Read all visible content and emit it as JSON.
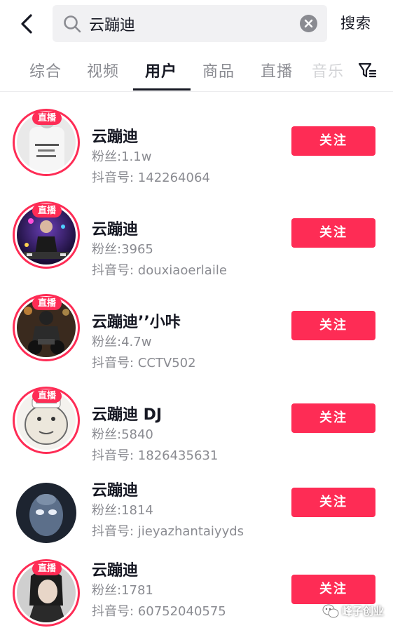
{
  "search": {
    "query": "云蹦迪",
    "button_label": "搜索"
  },
  "tabs": [
    {
      "label": "综合"
    },
    {
      "label": "视频"
    },
    {
      "label": "用户"
    },
    {
      "label": "商品"
    },
    {
      "label": "直播"
    },
    {
      "label": "音乐"
    }
  ],
  "active_tab": "用户",
  "colors": {
    "accent": "#fe2c55",
    "text_primary": "#161823",
    "text_secondary": "#8a8b91"
  },
  "users": [
    {
      "name": "云蹦迪",
      "fans": "粉丝:1.1w",
      "dy_id": "抖音号: 142264064",
      "live": "直播",
      "follow": "关注"
    },
    {
      "name": "云蹦迪",
      "fans": "粉丝:3965",
      "dy_id": "抖音号: douxiaoerlaile",
      "live": "直播",
      "follow": "关注"
    },
    {
      "name": "云蹦迪’’小咔",
      "fans": "粉丝:4.7w",
      "dy_id": "抖音号: CCTV502",
      "live": "直播",
      "follow": "关注"
    },
    {
      "name": "云蹦迪 DJ",
      "fans": "粉丝:5840",
      "dy_id": "抖音号: 1826435631",
      "live": "直播",
      "follow": "关注"
    },
    {
      "name": "云蹦迪",
      "fans": "粉丝:1814",
      "dy_id": "抖音号: jieyazhantaiyyds",
      "live": "",
      "follow": "关注"
    },
    {
      "name": "云蹦迪",
      "fans": "粉丝:1781",
      "dy_id": "抖音号: 60752040575",
      "live": "直播",
      "follow": "关注"
    }
  ],
  "watermark": {
    "text": "峰子创业",
    "icon": "wechat-icon"
  }
}
